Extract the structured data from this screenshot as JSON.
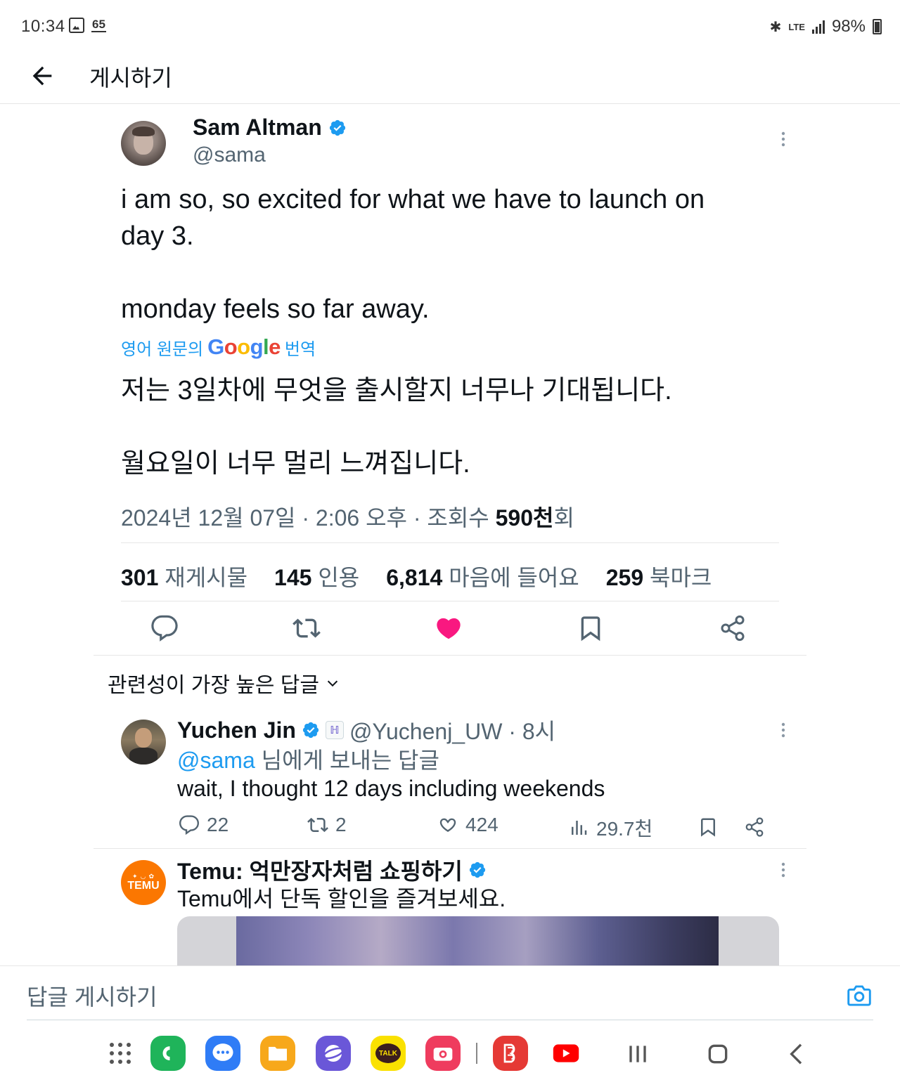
{
  "status_bar": {
    "time": "10:34",
    "badge": "65",
    "battery": "98%",
    "network": "LTE"
  },
  "header": {
    "title": "게시하기"
  },
  "post": {
    "author_name": "Sam Altman",
    "handle": "@sama",
    "text": "i am so, so excited for what we have to launch on\nday 3.\n\nmonday feels so far away.",
    "translate_prefix": "영어 원문의",
    "translate_google": "Google",
    "translate_suffix": "번역",
    "translated_text": "저는 3일차에 무엇을 출시할지 너무나 기대됩니다.\n\n월요일이 너무 멀리 느껴집니다.",
    "date": "2024년 12월 07일 · 2:06 오후 · 조회수",
    "views": "590천",
    "views_suffix": "회",
    "stats": [
      {
        "count": "301",
        "label": "재게시물"
      },
      {
        "count": "145",
        "label": "인용"
      },
      {
        "count": "6,814",
        "label": "마음에 들어요"
      },
      {
        "count": "259",
        "label": "북마크"
      }
    ]
  },
  "replies_sort": {
    "label": "관련성이 가장 높은 답글"
  },
  "reply": {
    "name": "Yuchen Jin",
    "affiliate_badge": "ℍ",
    "handle": "@Yuchenj_UW · 8시",
    "mention": "@sama",
    "replying_suffix": " 님에게 보내는 답글",
    "text": "wait, I thought 12 days including weekends",
    "replies": "22",
    "reposts": "2",
    "likes": "424",
    "views": "29.7천"
  },
  "ad": {
    "title": "Temu: 억만장자처럼 쇼핑하기",
    "text": "Temu에서 단독 할인을 즐겨보세요.",
    "logo_text": "TEMU"
  },
  "reply_bar": {
    "placeholder": "답글 게시하기"
  },
  "nav_bar": {
    "apps": [
      {
        "name": "phone",
        "color": "#1fb45a"
      },
      {
        "name": "messages",
        "color": "#2f7cf6"
      },
      {
        "name": "files",
        "color": "#f7a81b"
      },
      {
        "name": "internet",
        "color": "#6a57d8"
      },
      {
        "name": "kakaotalk",
        "label": "TALK",
        "color": "#fae100"
      },
      {
        "name": "camera",
        "color": "#ef3c5e"
      },
      {
        "name": "bookshelf",
        "color": "#e53935"
      },
      {
        "name": "youtube",
        "color": "#ff0000"
      }
    ]
  },
  "colors": {
    "accent": "#1d9bf0",
    "like": "#f91880",
    "secondary_text": "#536471"
  }
}
